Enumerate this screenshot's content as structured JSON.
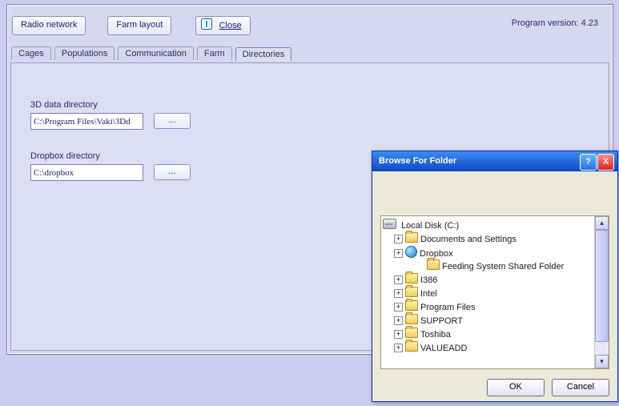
{
  "version_label": "Program version: 4.23",
  "toolbar": {
    "radio": "Radio network",
    "farm_layout": "Farm layout",
    "close": "Close"
  },
  "tabs": [
    "Cages",
    "Populations",
    "Communication",
    "Farm",
    "Directories"
  ],
  "active_tab_index": 4,
  "dir3d": {
    "label": "3D data directory",
    "value": "C:\\Program Files\\Vaki\\3Dd",
    "browse": "..."
  },
  "dropbox": {
    "label": "Dropbox directory",
    "value": "C:\\dropbox",
    "browse": "..."
  },
  "dialog": {
    "title": "Browse For Folder",
    "help": "?",
    "close": "X",
    "ok": "OK",
    "cancel": "Cancel",
    "tree": {
      "root": {
        "label": "Local Disk (C:)",
        "icon": "disk"
      },
      "nodes": [
        {
          "exp": "+",
          "icon": "fld",
          "label": "Documents and Settings"
        },
        {
          "exp": "+",
          "icon": "db",
          "label": "Dropbox"
        },
        {
          "exp": "",
          "icon": "fld",
          "label": "Feeding System Shared Folder",
          "indent": true
        },
        {
          "exp": "+",
          "icon": "fld",
          "label": "I386"
        },
        {
          "exp": "+",
          "icon": "fld",
          "label": "Intel"
        },
        {
          "exp": "+",
          "icon": "fld",
          "label": "Program Files"
        },
        {
          "exp": "+",
          "icon": "fld",
          "label": "SUPPORT"
        },
        {
          "exp": "+",
          "icon": "fld",
          "label": "Toshiba"
        },
        {
          "exp": "+",
          "icon": "fld",
          "label": "VALUEADD"
        }
      ]
    }
  }
}
